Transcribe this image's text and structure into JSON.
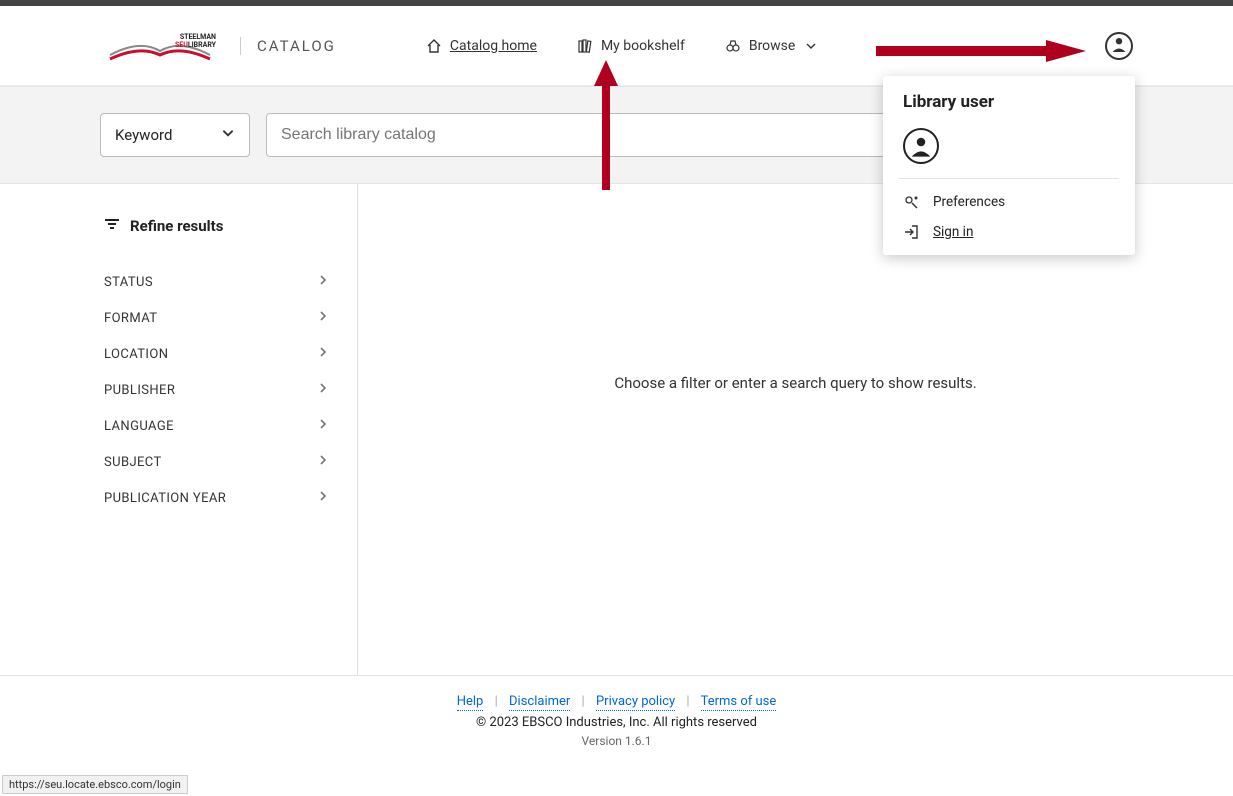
{
  "brand": {
    "line1": "STEELMAN",
    "seu": "SEU",
    "library": "LIBRARY",
    "catalog_label": "CATALOG"
  },
  "nav": {
    "home": "Catalog home",
    "bookshelf": "My bookshelf",
    "browse": "Browse"
  },
  "search": {
    "select_label": "Keyword",
    "placeholder": "Search library catalog"
  },
  "sidebar": {
    "refine_label": "Refine results",
    "facets": [
      "STATUS",
      "FORMAT",
      "LOCATION",
      "PUBLISHER",
      "LANGUAGE",
      "SUBJECT",
      "PUBLICATION YEAR"
    ]
  },
  "results": {
    "empty_prompt": "Choose a filter or enter a search query to show results."
  },
  "popover": {
    "title": "Library user",
    "preferences": "Preferences",
    "signin": "Sign in"
  },
  "footer": {
    "help": "Help",
    "disclaimer": "Disclaimer",
    "privacy": "Privacy policy",
    "terms": "Terms of use",
    "copyright": "© 2023 EBSCO Industries, Inc. All rights reserved",
    "version": "Version 1.6.1"
  },
  "status_url": "https://seu.locate.ebsco.com/login"
}
